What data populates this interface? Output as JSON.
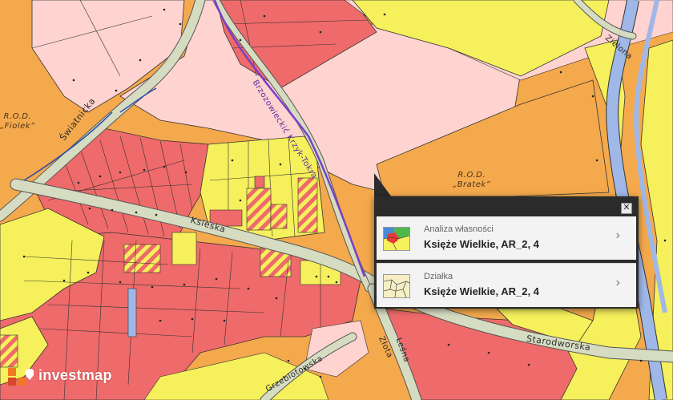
{
  "map": {
    "colors": {
      "orange": "#f4a94c",
      "light_pink": "#ffd3d0",
      "yellow": "#f5f05b",
      "red": "#ef6a6a",
      "road": "#d6dcc1",
      "river": "#9fb8e8",
      "stream": "#7b3fc7"
    },
    "labels": {
      "rod_fiolek": "R.O.D.\n„Fiolek”",
      "rod_bratek": "R.O.D.\n„Bratek”",
      "swiatnicka": "Światnicka",
      "ksieska": "Ksieska",
      "starodworska": "Starodworska",
      "zielona": "Zielona",
      "stream_name": "Brzozowieckić Krzyk-Tokra",
      "lesna": "Leśna",
      "zlota": "Złota",
      "grebowska": "Grzebiotowska"
    }
  },
  "popup": {
    "close_glyph": "✕",
    "items": [
      {
        "subtitle": "Analiza własności",
        "title": "Księże Wielkie, AR_2, 4",
        "icon": "ownership-analysis-icon"
      },
      {
        "subtitle": "Działka",
        "title": "Księże Wielkie, AR_2, 4",
        "icon": "parcel-icon"
      }
    ],
    "chevron": "›"
  },
  "brand": {
    "name": "investmap",
    "colors": {
      "orange": "#f07a22",
      "red": "#d9452a"
    }
  }
}
